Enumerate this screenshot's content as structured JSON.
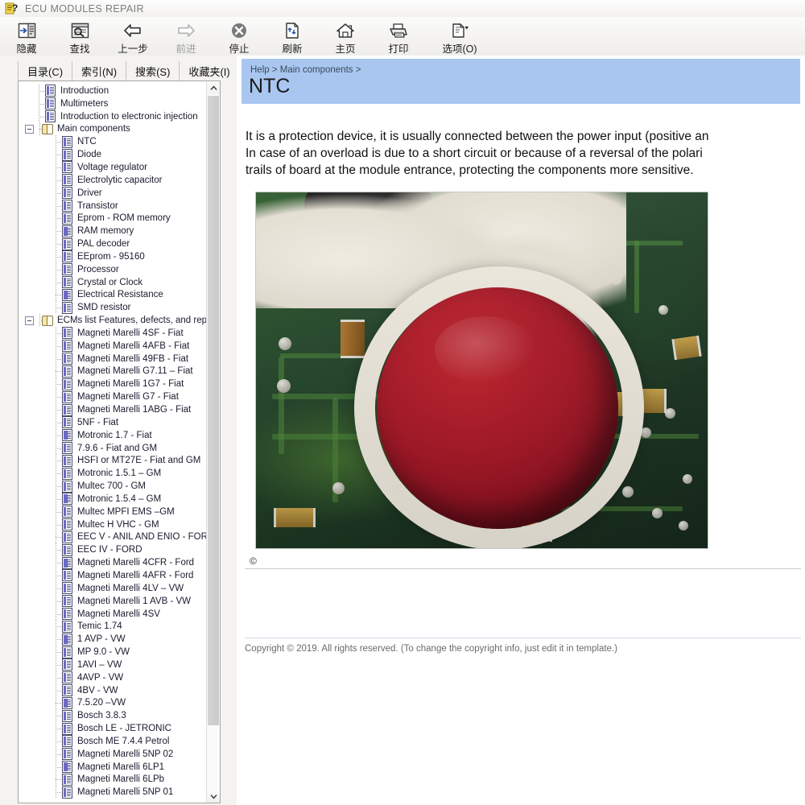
{
  "window": {
    "title": "ECU MODULES REPAIR",
    "icon": "help-question-icon"
  },
  "toolbar": {
    "buttons": [
      {
        "label": "隐藏",
        "icon": "hide-pane-icon",
        "disabled": false
      },
      {
        "label": "查找",
        "icon": "find-icon",
        "disabled": false
      },
      {
        "label": "上一步",
        "icon": "back-arrow-icon",
        "disabled": false
      },
      {
        "label": "前进",
        "icon": "forward-arrow-icon",
        "disabled": true
      },
      {
        "label": "停止",
        "icon": "stop-icon",
        "disabled": false
      },
      {
        "label": "刷新",
        "icon": "refresh-icon",
        "disabled": false
      },
      {
        "label": "主页",
        "icon": "home-icon",
        "disabled": false
      },
      {
        "label": "打印",
        "icon": "print-icon",
        "disabled": false
      },
      {
        "label": "选项(O)",
        "icon": "options-icon",
        "disabled": false
      }
    ]
  },
  "sidebar": {
    "tabs": [
      {
        "label": "目录(C)",
        "active": true
      },
      {
        "label": "索引(N)",
        "active": false
      },
      {
        "label": "搜索(S)",
        "active": false
      },
      {
        "label": "收藏夹(I)",
        "active": false
      }
    ],
    "tree": [
      {
        "label": "Introduction",
        "type": "doc",
        "level": 1
      },
      {
        "label": "Multimeters",
        "type": "doc",
        "level": 1
      },
      {
        "label": "Introduction to electronic injection",
        "type": "doc",
        "level": 1
      },
      {
        "label": "Main components",
        "type": "book",
        "level": 0,
        "expanded": true
      },
      {
        "label": "NTC",
        "type": "doc",
        "level": 2,
        "selected": true
      },
      {
        "label": "Diode",
        "type": "doc",
        "level": 2
      },
      {
        "label": "Voltage regulator",
        "type": "doc",
        "level": 2
      },
      {
        "label": "Electrolytic capacitor",
        "type": "doc",
        "level": 2
      },
      {
        "label": "Driver",
        "type": "doc",
        "level": 2
      },
      {
        "label": "Transistor",
        "type": "doc",
        "level": 2
      },
      {
        "label": "Eprom - ROM memory",
        "type": "doc",
        "level": 2
      },
      {
        "label": "RAM memory",
        "type": "doc-solid",
        "level": 2
      },
      {
        "label": "PAL decoder",
        "type": "doc",
        "level": 2
      },
      {
        "label": "EEprom - 95160",
        "type": "doc",
        "level": 2
      },
      {
        "label": "Processor",
        "type": "doc",
        "level": 2
      },
      {
        "label": "Crystal or Clock",
        "type": "doc",
        "level": 2
      },
      {
        "label": "Electrical Resistance",
        "type": "doc-solid",
        "level": 2
      },
      {
        "label": "SMD resistor",
        "type": "doc",
        "level": 2
      },
      {
        "label": "ECMs list Features, defects, and repair",
        "type": "book",
        "level": 0,
        "expanded": true
      },
      {
        "label": "Magneti Marelli 4SF - Fiat",
        "type": "doc",
        "level": 2
      },
      {
        "label": "Magneti Marelli 4AFB - Fiat",
        "type": "doc",
        "level": 2
      },
      {
        "label": "Magneti Marelli 49FB - Fiat",
        "type": "doc",
        "level": 2
      },
      {
        "label": "Magneti Marelli G7.11 – Fiat",
        "type": "doc",
        "level": 2
      },
      {
        "label": "Magneti Marelli 1G7 - Fiat",
        "type": "doc",
        "level": 2
      },
      {
        "label": "Magneti Marelli G7 - Fiat",
        "type": "doc",
        "level": 2
      },
      {
        "label": "Magneti Marelli 1ABG - Fiat",
        "type": "doc",
        "level": 2
      },
      {
        "label": "5NF - Fiat",
        "type": "doc",
        "level": 2
      },
      {
        "label": "Motronic 1.7 - Fiat",
        "type": "doc-solid",
        "level": 2
      },
      {
        "label": "7.9.6 - Fiat and GM",
        "type": "doc",
        "level": 2
      },
      {
        "label": "HSFI or MT27E - Fiat and GM",
        "type": "doc",
        "level": 2
      },
      {
        "label": "Motronic 1.5.1 – GM",
        "type": "doc",
        "level": 2
      },
      {
        "label": "Multec 700 - GM",
        "type": "doc",
        "level": 2
      },
      {
        "label": "Motronic 1.5.4 – GM",
        "type": "doc-solid",
        "level": 2
      },
      {
        "label": "Multec MPFI EMS –GM",
        "type": "doc",
        "level": 2
      },
      {
        "label": "Multec H VHC - GM",
        "type": "doc",
        "level": 2
      },
      {
        "label": "EEC V - ANIL AND ENIO - FORD",
        "type": "doc",
        "level": 2
      },
      {
        "label": "EEC IV - FORD",
        "type": "doc",
        "level": 2
      },
      {
        "label": "Magneti Marelli 4CFR - Ford",
        "type": "doc-solid",
        "level": 2
      },
      {
        "label": "Magneti Marelli 4AFR - Ford",
        "type": "doc",
        "level": 2
      },
      {
        "label": "Magneti Marelli 4LV – VW",
        "type": "doc",
        "level": 2
      },
      {
        "label": "Magneti Marelli 1 AVB - VW",
        "type": "doc",
        "level": 2
      },
      {
        "label": "Magneti Marelli 4SV",
        "type": "doc",
        "level": 2
      },
      {
        "label": "Temic 1.74",
        "type": "doc",
        "level": 2
      },
      {
        "label": "1 AVP - VW",
        "type": "doc-solid",
        "level": 2
      },
      {
        "label": "MP 9.0 - VW",
        "type": "doc",
        "level": 2
      },
      {
        "label": "1AVI – VW",
        "type": "doc",
        "level": 2
      },
      {
        "label": "4AVP - VW",
        "type": "doc",
        "level": 2
      },
      {
        "label": "4BV - VW",
        "type": "doc",
        "level": 2
      },
      {
        "label": "7.5.20 –VW",
        "type": "doc-solid",
        "level": 2
      },
      {
        "label": "Bosch 3.8.3",
        "type": "doc",
        "level": 2
      },
      {
        "label": "Bosch LE - JETRONIC",
        "type": "doc",
        "level": 2
      },
      {
        "label": "Bosch ME 7.4.4 Petrol",
        "type": "doc",
        "level": 2
      },
      {
        "label": "Magneti Marelli 5NP 02",
        "type": "doc",
        "level": 2
      },
      {
        "label": "Magneti Marelli 6LP1",
        "type": "doc-solid",
        "level": 2
      },
      {
        "label": "Magneti Marelli 6LPb",
        "type": "doc",
        "level": 2
      },
      {
        "label": "Magneti Marelli 5NP 01",
        "type": "doc",
        "level": 2
      }
    ]
  },
  "content": {
    "breadcrumb": "Help > Main components >",
    "title": "NTC",
    "paragraph_lines": [
      "It is a protection device, it is usually connected between the power input (positive an",
      "In case of an overload is due to a short circuit or because of a reversal of the polari",
      "trails of board at the module entrance, protecting the components more sensitive."
    ],
    "image_caption_mark": "©",
    "image_alt": "Photograph of a circuit board with a red NTC thermistor surrounded by white glue",
    "footer": "Copyright © 2019. All rights reserved. (To change the copyright info, just edit it in template.)"
  },
  "colors": {
    "header_band": "#a9c6f0",
    "titlebar_text": "#7c7c7c",
    "toolbar_bg": "#f3f2ef",
    "tree_bg": "#ffffff",
    "ntc_red": "#a81726",
    "pcb_green": "#2e5a2c"
  }
}
